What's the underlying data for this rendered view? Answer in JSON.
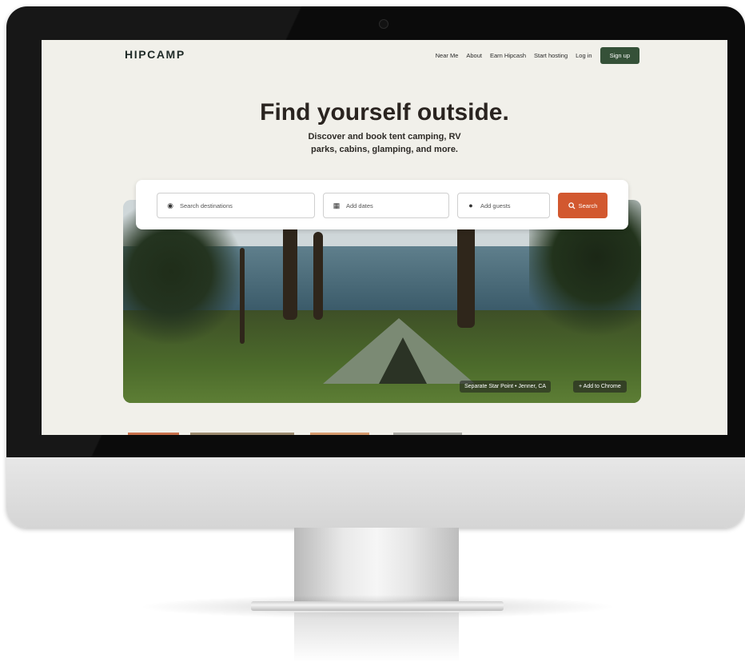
{
  "header": {
    "logo": "HIPCAMP",
    "nav": [
      "Near Me",
      "About",
      "Earn Hipcash",
      "Start hosting",
      "Log in"
    ],
    "signup_label": "Sign up"
  },
  "hero": {
    "title": "Find yourself outside.",
    "subtitle": "Discover and book tent camping, RV parks, cabins, glamping, and more."
  },
  "search": {
    "destination_placeholder": "Search destinations",
    "dates_placeholder": "Add dates",
    "guests_placeholder": "Add guests",
    "button_label": "Search"
  },
  "photo": {
    "credit": "Separate Star Point • Jenner, CA",
    "chrome_button": "+ Add to Chrome"
  },
  "colors": {
    "signup_bg": "#355138",
    "search_button_bg": "#d2582f",
    "screen_bg": "#f1f0ea"
  },
  "icons": {
    "destination": "location-pin-icon",
    "dates": "calendar-icon",
    "guests": "person-icon",
    "search": "magnifier-icon",
    "camera": "webcam-icon"
  }
}
